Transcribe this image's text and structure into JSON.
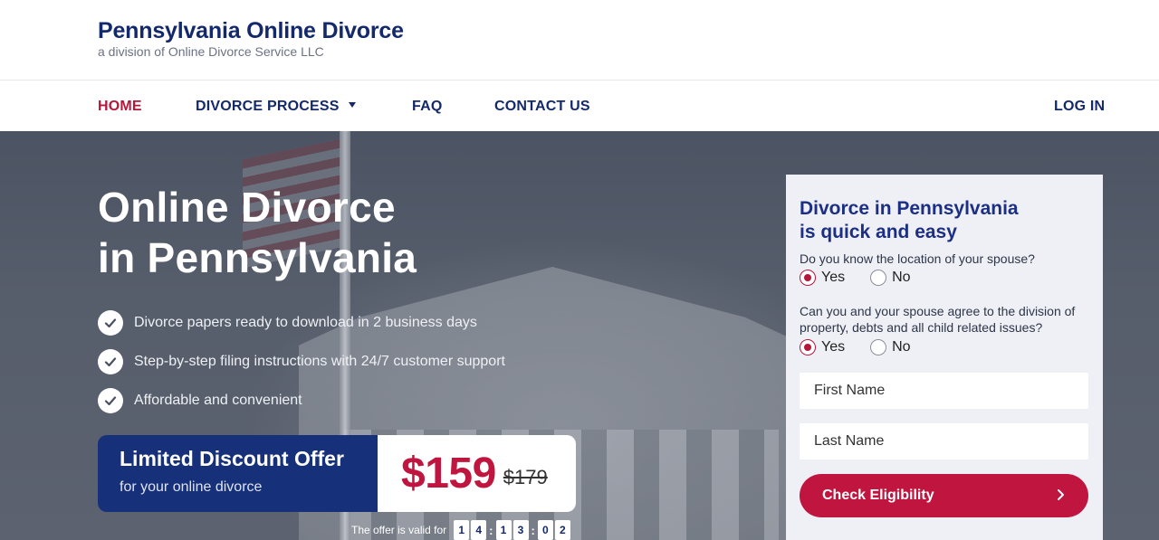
{
  "header": {
    "title": "Pennsylvania Online Divorce",
    "subtitle": "a division of Online Divorce Service LLC"
  },
  "nav": {
    "home": "HOME",
    "divorce_process": "DIVORCE PROCESS",
    "faq": "FAQ",
    "contact": "CONTACT US",
    "login": "LOG IN"
  },
  "hero": {
    "title_line1": "Online Divorce",
    "title_line2": "in Pennsylvania",
    "benefits": [
      "Divorce papers ready to download in 2 business days",
      "Step-by-step filing instructions with 24/7 customer support",
      "Affordable and convenient"
    ],
    "offer": {
      "title": "Limited Discount Offer",
      "subtitle": "for your online divorce",
      "price": "$159",
      "old_price": "$179"
    },
    "timer": {
      "label": "The offer is valid for",
      "digits": [
        "1",
        "4",
        "1",
        "3",
        "0",
        "2"
      ]
    }
  },
  "form": {
    "title_line1": "Divorce in Pennsylvania",
    "title_line2": "is quick and easy",
    "q1": "Do you know the location of your spouse?",
    "q2": "Can you and your spouse agree to the division of property, debts and all child related issues?",
    "yes": "Yes",
    "no": "No",
    "q1_selected": "Yes",
    "q2_selected": "Yes",
    "first_name_placeholder": "First Name",
    "last_name_placeholder": "Last Name",
    "cta": "Check Eligibility"
  },
  "colors": {
    "brand_navy": "#14296b",
    "accent_red": "#c0153f",
    "offer_blue": "#16307a"
  }
}
